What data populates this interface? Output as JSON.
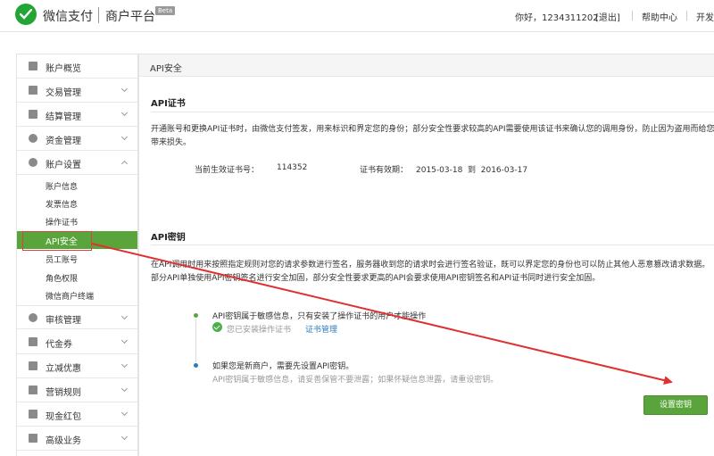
{
  "header": {
    "brand": "微信支付",
    "brand2": "商户平台",
    "beta": "Beta",
    "greeting": "你好，1234311202",
    "logout": "[退出]",
    "help": "帮助中心",
    "dev": "开发"
  },
  "sidebar": {
    "items": [
      {
        "label": "账户概览",
        "icon": "grid-icon"
      },
      {
        "label": "交易管理",
        "icon": "list-icon"
      },
      {
        "label": "结算管理",
        "icon": "settlement-icon"
      },
      {
        "label": "资金管理",
        "icon": "money-bag-icon"
      },
      {
        "label": "账户设置",
        "icon": "gear-icon"
      },
      {
        "label": "审核管理",
        "icon": "audit-icon"
      },
      {
        "label": "代金券",
        "icon": "coupon-icon"
      },
      {
        "label": "立减优惠",
        "icon": "discount-icon"
      },
      {
        "label": "营销规则",
        "icon": "rules-icon"
      },
      {
        "label": "现金红包",
        "icon": "red-packet-icon"
      },
      {
        "label": "高级业务",
        "icon": "advanced-icon"
      }
    ],
    "sub_items": [
      "账户信息",
      "发票信息",
      "操作证书",
      "API安全",
      "员工账号",
      "角色权限",
      "微信商户终端"
    ]
  },
  "content": {
    "page_title": "API安全",
    "cert_title": "API证书",
    "cert_desc": "开通账号和更换API证书时，由微信支付签发，用来标识和界定您的身份；部分安全性要求较高的API需要使用该证书来确认您的调用身份，防止因为盗用而给您带来损失。",
    "cert_no_label": "当前生效证书号：",
    "cert_no": "114352",
    "cert_valid_label": "证书有效期：",
    "cert_valid": "2015-03-18  到  2016-03-17",
    "key_title": "API密钥",
    "key_desc": "在API调用时用来按照指定规则对您的请求参数进行签名，服务器收到您的请求时会进行签名验证，既可以界定您的身份也可以防止其他人恶意篡改请求数据。部分API单独使用API密钥签名进行安全加固，部分安全性要求更高的API会要求使用API密钥签名和API证书同时进行安全加固。",
    "step1_title": "API密钥属于敏感信息，只有安装了操作证书的用户才能操作",
    "step1_status": "您已安装操作证书",
    "step1_link": "证书管理",
    "step2_title": "如果您是新商户，需要先设置API密钥。",
    "step2_note": "API密钥属于敏感信息，请妥善保管不要泄露；如果怀疑信息泄露，请重设密钥。",
    "set_key_button": "设置密钥"
  },
  "colors": {
    "brand_green": "#21a535",
    "active_green": "#5aa53b",
    "annotation_red": "#e03030",
    "link_blue": "#2a7bc0"
  }
}
